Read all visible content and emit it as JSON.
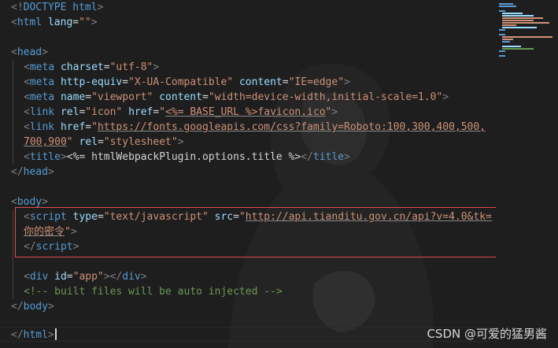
{
  "editor": {
    "lines": [
      {
        "l1_a": "<!",
        "l1_b": "DOCTYPE",
        "l1_c": " html",
        "l1_d": ">"
      },
      {},
      {},
      {},
      {},
      {},
      {},
      {},
      {},
      {},
      {},
      {}
    ],
    "l_doctype_open": "<!",
    "l_doctype_kw": "DOCTYPE",
    "l_doctype_html": " html",
    "l_doctype_close": ">",
    "html_open_tag": "html",
    "html_lang_attr": "lang",
    "html_lang_val": "\"\"",
    "head_tag": "head",
    "meta_tag": "meta",
    "charset_attr": "charset",
    "charset_val": "\"utf-8\"",
    "http_equiv_attr": "http-equiv",
    "http_equiv_val": "\"X-UA-Compatible\"",
    "content_attr": "content",
    "ie_edge_val": "\"IE=edge\"",
    "name_attr": "name",
    "viewport_val": "\"viewport\"",
    "viewport_content_val": "\"width=device-width,initial-scale=1.0\"",
    "link_tag": "link",
    "rel_attr": "rel",
    "icon_val": "\"icon\"",
    "href_attr": "href",
    "favicon_q1": "\"",
    "favicon_link": "<%= BASE_URL %>favicon.ico",
    "favicon_q2": "\"",
    "fonts_q1": "\"",
    "fonts_link_1": "https://fonts.googleapis.com/css?family=Roboto:100,300,400,500,",
    "fonts_link_2": "700,900",
    "fonts_q2": "\"",
    "stylesheet_val": "\"stylesheet\"",
    "title_tag": "title",
    "title_text": "<%= htmlWebpackPlugin.options.title %>",
    "body_tag": "body",
    "script_tag": "script",
    "type_attr": "type",
    "type_val": "\"text/javascript\"",
    "src_attr": "src",
    "src_q1": "\"",
    "src_link_1": "http://api.tianditu.gov.cn/api?v=4.0&tk=",
    "src_link_2": "你的密令",
    "src_q2": "\"",
    "div_tag": "div",
    "id_attr": "id",
    "app_val": "\"app\"",
    "comment_text": "<!-- built files will be auto injected -->",
    "lt": "<",
    "gt": ">",
    "lt_slash": "</",
    "eq": "="
  },
  "watermark": "CSDN @可爱的猛男酱",
  "colors": {
    "background": "#1e1e1e",
    "tag": "#569cd6",
    "attribute": "#9cdcfe",
    "string": "#ce9178",
    "comment": "#6a9955",
    "bracket": "#808080",
    "highlight_box": "#e04b4b"
  }
}
